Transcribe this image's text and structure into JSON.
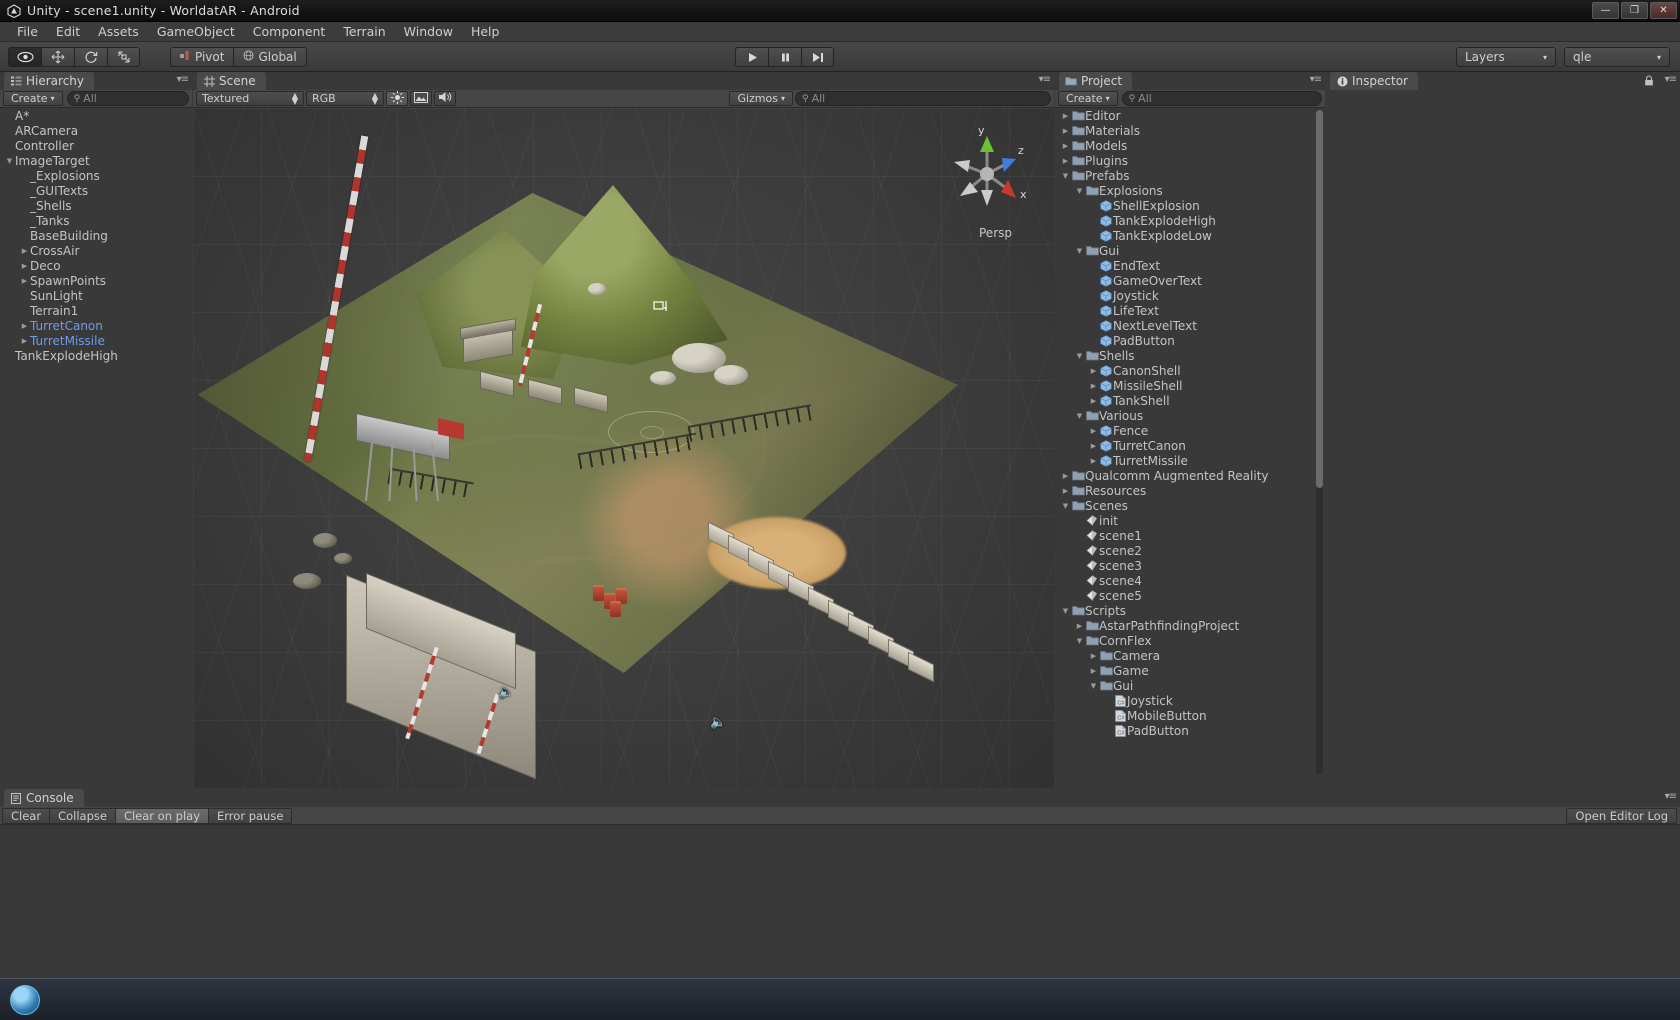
{
  "window": {
    "title": "Unity - scene1.unity - WorldatAR - Android",
    "app_icon": "unity-logo-icon",
    "minimize": "—",
    "maximize": "❐",
    "close": "✕"
  },
  "menubar": {
    "items": [
      "File",
      "Edit",
      "Assets",
      "GameObject",
      "Component",
      "Terrain",
      "Window",
      "Help"
    ]
  },
  "toolbar": {
    "tools": [
      {
        "name": "hand-tool",
        "glyph": "◉",
        "active": true
      },
      {
        "name": "move-tool",
        "glyph": "✛",
        "active": false
      },
      {
        "name": "rotate-tool",
        "glyph": "↻",
        "active": false
      },
      {
        "name": "scale-tool",
        "glyph": "⤡",
        "active": false
      }
    ],
    "pivot_label": "Pivot",
    "global_label": "Global",
    "play_label": "▶",
    "pause_label": "‖",
    "step_label": "▶|",
    "layers_label": "Layers",
    "layout_label": "qle",
    "caret": "▾"
  },
  "hierarchy": {
    "tab_label": "Hierarchy",
    "tab_icon": "hierarchy-icon",
    "create_label": "Create",
    "create_caret": "▾",
    "search_placeholder": "All",
    "search_icon": "search-icon",
    "options_icon": "panel-options-icon",
    "items": [
      {
        "label": "A*",
        "depth": 0,
        "arrow": "none",
        "prefab": false
      },
      {
        "label": "ARCamera",
        "depth": 0,
        "arrow": "none",
        "prefab": false
      },
      {
        "label": "Controller",
        "depth": 0,
        "arrow": "none",
        "prefab": false
      },
      {
        "label": "ImageTarget",
        "depth": 0,
        "arrow": "open",
        "prefab": false
      },
      {
        "label": "_Explosions",
        "depth": 1,
        "arrow": "none",
        "prefab": false
      },
      {
        "label": "_GUITexts",
        "depth": 1,
        "arrow": "none",
        "prefab": false
      },
      {
        "label": "_Shells",
        "depth": 1,
        "arrow": "none",
        "prefab": false
      },
      {
        "label": "_Tanks",
        "depth": 1,
        "arrow": "none",
        "prefab": false
      },
      {
        "label": "BaseBuilding",
        "depth": 1,
        "arrow": "none",
        "prefab": false
      },
      {
        "label": "CrossAir",
        "depth": 1,
        "arrow": "closed",
        "prefab": false
      },
      {
        "label": "Deco",
        "depth": 1,
        "arrow": "closed",
        "prefab": false
      },
      {
        "label": "SpawnPoints",
        "depth": 1,
        "arrow": "closed",
        "prefab": false
      },
      {
        "label": "SunLight",
        "depth": 1,
        "arrow": "none",
        "prefab": false
      },
      {
        "label": "Terrain1",
        "depth": 1,
        "arrow": "none",
        "prefab": false
      },
      {
        "label": "TurretCanon",
        "depth": 1,
        "arrow": "closed",
        "prefab": true
      },
      {
        "label": "TurretMissile",
        "depth": 1,
        "arrow": "closed",
        "prefab": true
      },
      {
        "label": "TankExplodeHigh",
        "depth": 0,
        "arrow": "none",
        "prefab": false
      }
    ]
  },
  "scene": {
    "tab_label": "Scene",
    "tab_icon": "scene-grid-icon",
    "draw_mode": "Textured",
    "color_mode": "RGB",
    "light_icon": "sun-icon",
    "fx_icon": "image-effects-icon",
    "audio_icon": "audio-icon",
    "gizmos_label": "Gizmos",
    "gizmos_caret": "▾",
    "search_placeholder": "All",
    "projection_label": "Persp",
    "axis_labels": {
      "x": "x",
      "y": "y",
      "z": "z"
    },
    "options_icon": "panel-options-icon"
  },
  "project": {
    "tab_label": "Project",
    "tab_icon": "folder-icon",
    "create_label": "Create",
    "create_caret": "▾",
    "search_placeholder": "All",
    "options_icon": "panel-options-icon",
    "items": [
      {
        "label": "Editor",
        "depth": 0,
        "arrow": "closed",
        "icon": "folder"
      },
      {
        "label": "Materials",
        "depth": 0,
        "arrow": "closed",
        "icon": "folder"
      },
      {
        "label": "Models",
        "depth": 0,
        "arrow": "closed",
        "icon": "folder"
      },
      {
        "label": "Plugins",
        "depth": 0,
        "arrow": "closed",
        "icon": "folder"
      },
      {
        "label": "Prefabs",
        "depth": 0,
        "arrow": "open",
        "icon": "folder"
      },
      {
        "label": "Explosions",
        "depth": 1,
        "arrow": "open",
        "icon": "folder"
      },
      {
        "label": "ShellExplosion",
        "depth": 2,
        "arrow": "none",
        "icon": "prefab"
      },
      {
        "label": "TankExplodeHigh",
        "depth": 2,
        "arrow": "none",
        "icon": "prefab"
      },
      {
        "label": "TankExplodeLow",
        "depth": 2,
        "arrow": "none",
        "icon": "prefab"
      },
      {
        "label": "Gui",
        "depth": 1,
        "arrow": "open",
        "icon": "folder"
      },
      {
        "label": "EndText",
        "depth": 2,
        "arrow": "none",
        "icon": "prefab"
      },
      {
        "label": "GameOverText",
        "depth": 2,
        "arrow": "none",
        "icon": "prefab"
      },
      {
        "label": "Joystick",
        "depth": 2,
        "arrow": "none",
        "icon": "prefab"
      },
      {
        "label": "LifeText",
        "depth": 2,
        "arrow": "none",
        "icon": "prefab"
      },
      {
        "label": "NextLevelText",
        "depth": 2,
        "arrow": "none",
        "icon": "prefab"
      },
      {
        "label": "PadButton",
        "depth": 2,
        "arrow": "none",
        "icon": "prefab"
      },
      {
        "label": "Shells",
        "depth": 1,
        "arrow": "open",
        "icon": "folder"
      },
      {
        "label": "CanonShell",
        "depth": 2,
        "arrow": "closed",
        "icon": "prefab"
      },
      {
        "label": "MissileShell",
        "depth": 2,
        "arrow": "closed",
        "icon": "prefab"
      },
      {
        "label": "TankShell",
        "depth": 2,
        "arrow": "closed",
        "icon": "prefab"
      },
      {
        "label": "Various",
        "depth": 1,
        "arrow": "open",
        "icon": "folder"
      },
      {
        "label": "Fence",
        "depth": 2,
        "arrow": "closed",
        "icon": "prefab"
      },
      {
        "label": "TurretCanon",
        "depth": 2,
        "arrow": "closed",
        "icon": "prefab"
      },
      {
        "label": "TurretMissile",
        "depth": 2,
        "arrow": "closed",
        "icon": "prefab"
      },
      {
        "label": "Qualcomm Augmented Reality",
        "depth": 0,
        "arrow": "closed",
        "icon": "folder"
      },
      {
        "label": "Resources",
        "depth": 0,
        "arrow": "closed",
        "icon": "folder"
      },
      {
        "label": "Scenes",
        "depth": 0,
        "arrow": "open",
        "icon": "folder"
      },
      {
        "label": "init",
        "depth": 1,
        "arrow": "none",
        "icon": "scene"
      },
      {
        "label": "scene1",
        "depth": 1,
        "arrow": "none",
        "icon": "scene"
      },
      {
        "label": "scene2",
        "depth": 1,
        "arrow": "none",
        "icon": "scene"
      },
      {
        "label": "scene3",
        "depth": 1,
        "arrow": "none",
        "icon": "scene"
      },
      {
        "label": "scene4",
        "depth": 1,
        "arrow": "none",
        "icon": "scene"
      },
      {
        "label": "scene5",
        "depth": 1,
        "arrow": "none",
        "icon": "scene"
      },
      {
        "label": "Scripts",
        "depth": 0,
        "arrow": "open",
        "icon": "folder"
      },
      {
        "label": "AstarPathfindingProject",
        "depth": 1,
        "arrow": "closed",
        "icon": "folder"
      },
      {
        "label": "CornFlex",
        "depth": 1,
        "arrow": "open",
        "icon": "folder"
      },
      {
        "label": "Camera",
        "depth": 2,
        "arrow": "closed",
        "icon": "folder"
      },
      {
        "label": "Game",
        "depth": 2,
        "arrow": "closed",
        "icon": "folder"
      },
      {
        "label": "Gui",
        "depth": 2,
        "arrow": "open",
        "icon": "folder"
      },
      {
        "label": "Joystick",
        "depth": 3,
        "arrow": "none",
        "icon": "script"
      },
      {
        "label": "MobileButton",
        "depth": 3,
        "arrow": "none",
        "icon": "script"
      },
      {
        "label": "PadButton",
        "depth": 3,
        "arrow": "none",
        "icon": "script"
      }
    ]
  },
  "inspector": {
    "tab_label": "Inspector",
    "tab_icon": "info-icon",
    "lock_icon": "lock-icon",
    "options_icon": "panel-options-icon"
  },
  "console": {
    "tab_label": "Console",
    "tab_icon": "console-icon",
    "clear_label": "Clear",
    "collapse_label": "Collapse",
    "clear_on_play_label": "Clear on play",
    "error_pause_label": "Error pause",
    "open_editor_log_label": "Open Editor Log",
    "options_icon": "panel-options-icon"
  },
  "taskbar": {
    "start_icon": "start-orb-icon"
  },
  "colors": {
    "prefab_blue": "#6f9ae8",
    "panel_bg": "#393939",
    "toolbar_bg": "#464646"
  }
}
